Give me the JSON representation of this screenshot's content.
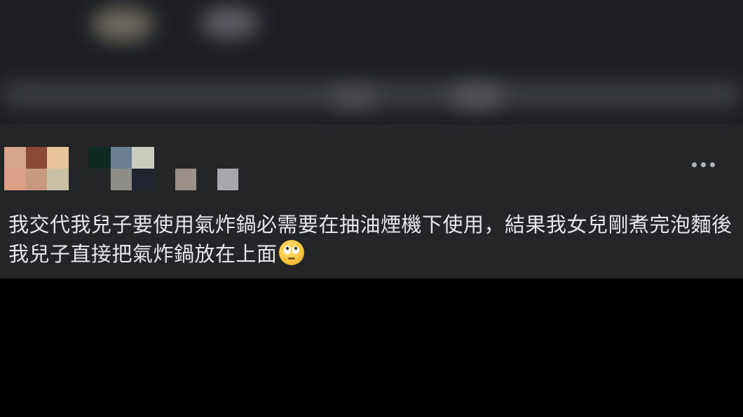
{
  "post": {
    "text": "我交代我兒子要使用氣炸鍋必需要在抽油煙機下使用，結果我女兒剛煮完泡麵後我兒子直接把氣炸鍋放在上面",
    "emoji": "face-with-rolling-eyes-icon",
    "more_options_icon": "ellipsis-horizontal-icon"
  },
  "colors": {
    "card_background": "#242526",
    "text": "#e4e6eb",
    "secondary_icon": "#b0b3b8",
    "page_background": "#000000"
  }
}
